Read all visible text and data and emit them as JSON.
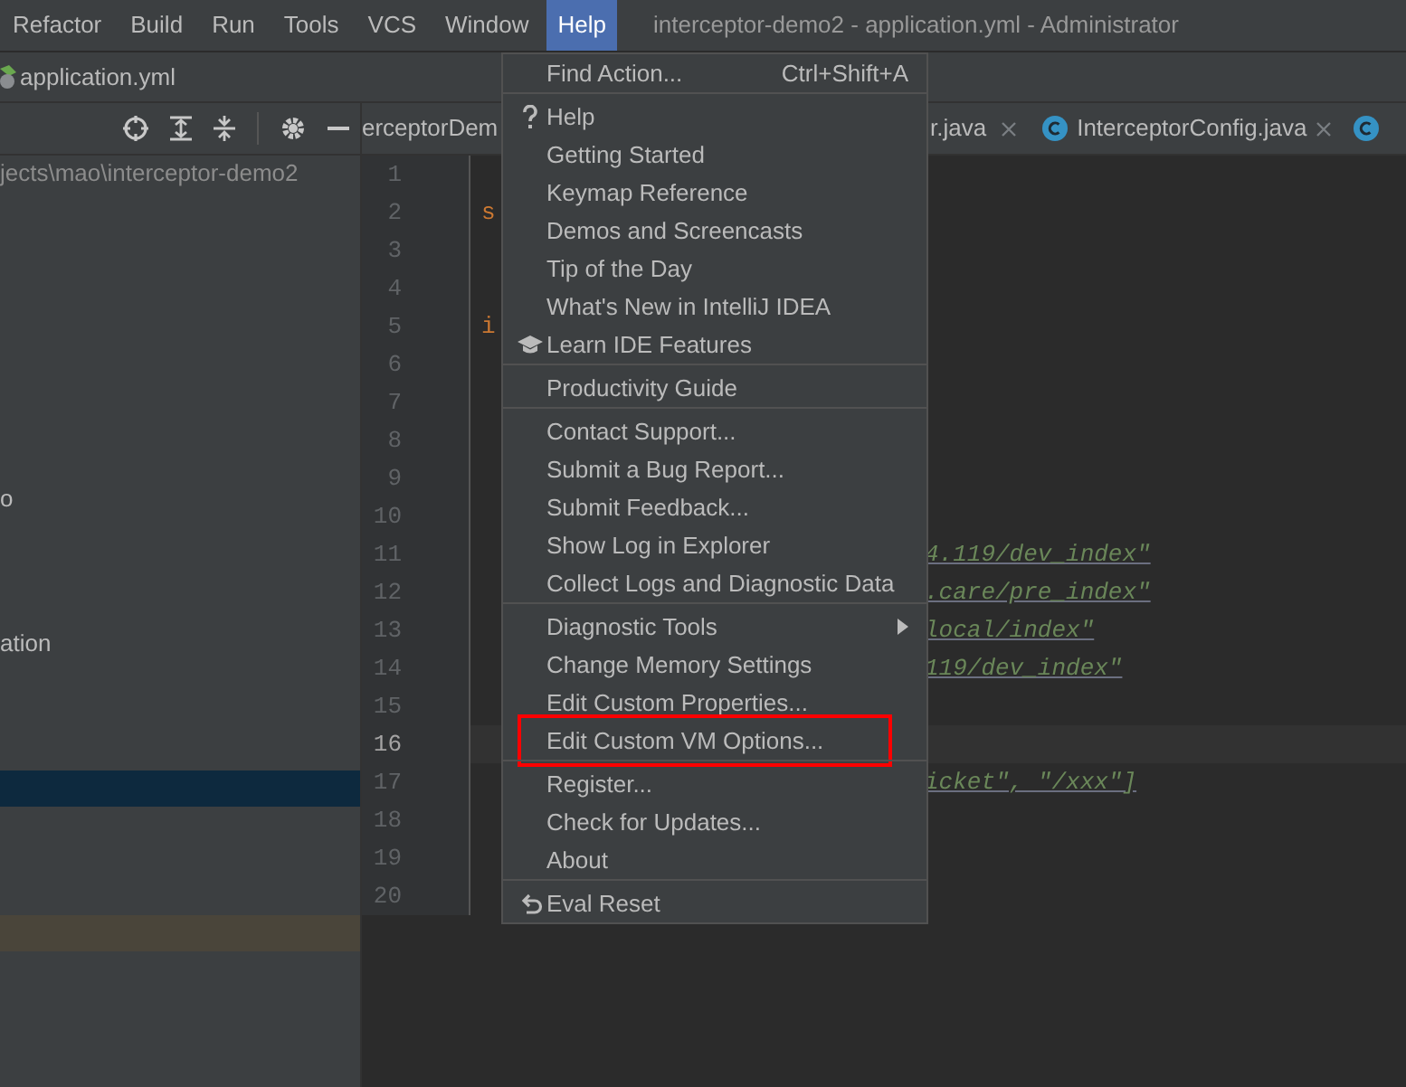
{
  "menubar": {
    "items": [
      {
        "label": "Refactor",
        "selected": false
      },
      {
        "label": "Build",
        "selected": false
      },
      {
        "label": "Run",
        "selected": false
      },
      {
        "label": "Tools",
        "selected": false
      },
      {
        "label": "VCS",
        "selected": false
      },
      {
        "label": "Window",
        "selected": false
      },
      {
        "label": "Help",
        "selected": true
      }
    ],
    "title": "interceptor-demo2 - application.yml - Administrator"
  },
  "breadcrumb": {
    "file": "application.yml"
  },
  "project_panel": {
    "rows": [
      {
        "text": "jects\\mao\\interceptor-demo2",
        "selected": false,
        "highlighted": false
      },
      {
        "text": "o",
        "selected": false,
        "highlighted": false
      },
      {
        "text": "ation",
        "selected": false,
        "highlighted": false
      },
      {
        "selected": true,
        "highlighted": false
      },
      {
        "selected": false,
        "highlighted": true
      }
    ]
  },
  "editor_tabs": [
    {
      "label": "erceptorDem",
      "kind": "plain",
      "selected": false
    },
    {
      "label": "r.java",
      "kind": "closable",
      "selected": false
    },
    {
      "label": "InterceptorConfig.java",
      "kind": "class",
      "selected": false
    },
    {
      "kind": "class-cut",
      "selected": false
    }
  ],
  "editor": {
    "lines": [
      {
        "number": "1",
        "current": false
      },
      {
        "number": "2",
        "text": "s",
        "kind": "key",
        "current": false
      },
      {
        "number": "3",
        "current": false
      },
      {
        "number": "4",
        "current": false
      },
      {
        "number": "5",
        "text": "i",
        "kind": "key",
        "current": false
      },
      {
        "number": "6",
        "current": false
      },
      {
        "number": "7",
        "current": false
      },
      {
        "number": "8",
        "current": false
      },
      {
        "number": "9",
        "current": false
      },
      {
        "number": "10",
        "current": false
      },
      {
        "number": "11",
        "text": "4.119/dev_index\"",
        "kind": "string",
        "current": false
      },
      {
        "number": "12",
        "text": ".care/pre_index\"",
        "kind": "string",
        "current": false
      },
      {
        "number": "13",
        "text": "local/index\"",
        "kind": "string",
        "current": false
      },
      {
        "number": "14",
        "text": "119/dev_index\"",
        "kind": "string",
        "current": false
      },
      {
        "number": "15",
        "current": false
      },
      {
        "number": "16",
        "current": true
      },
      {
        "number": "17",
        "text": "icket\", \"/xxx\"]",
        "kind": "string",
        "current": false
      },
      {
        "number": "18",
        "current": false
      },
      {
        "number": "19",
        "current": false
      },
      {
        "number": "20",
        "current": false
      }
    ]
  },
  "help_menu": {
    "groups": [
      [
        {
          "label": "Find Action...",
          "shortcut": "Ctrl+Shift+A",
          "kind": "item",
          "marked": false
        }
      ],
      [
        {
          "label": "Help",
          "kind": "help",
          "marked": false
        },
        {
          "label": "Getting Started",
          "kind": "item",
          "marked": false
        },
        {
          "label": "Keymap Reference",
          "kind": "item",
          "marked": false
        },
        {
          "label": "Demos and Screencasts",
          "kind": "item",
          "marked": false
        },
        {
          "label": "Tip of the Day",
          "kind": "item",
          "marked": false
        },
        {
          "label": "What's New in IntelliJ IDEA",
          "kind": "item",
          "marked": false
        },
        {
          "label": "Learn IDE Features",
          "kind": "learn",
          "marked": false
        }
      ],
      [
        {
          "label": "Productivity Guide",
          "kind": "item",
          "marked": false
        }
      ],
      [
        {
          "label": "Contact Support...",
          "kind": "item",
          "marked": false
        },
        {
          "label": "Submit a Bug Report...",
          "kind": "item",
          "marked": false
        },
        {
          "label": "Submit Feedback...",
          "kind": "item",
          "marked": false
        },
        {
          "label": "Show Log in Explorer",
          "kind": "item",
          "marked": false
        },
        {
          "label": "Collect Logs and Diagnostic Data",
          "kind": "item",
          "marked": false
        }
      ],
      [
        {
          "label": "Diagnostic Tools",
          "kind": "submenu",
          "marked": false
        },
        {
          "label": "Change Memory Settings",
          "kind": "item",
          "marked": false
        },
        {
          "label": "Edit Custom Properties...",
          "kind": "item",
          "marked": false
        },
        {
          "label": "Edit Custom VM Options...",
          "kind": "item",
          "marked": true
        }
      ],
      [
        {
          "label": "Register...",
          "kind": "item",
          "marked": false
        },
        {
          "label": "Check for Updates...",
          "kind": "item",
          "marked": false
        },
        {
          "label": "About",
          "kind": "item",
          "marked": false
        }
      ],
      [
        {
          "label": "Eval Reset",
          "kind": "reset",
          "marked": false
        }
      ]
    ]
  }
}
